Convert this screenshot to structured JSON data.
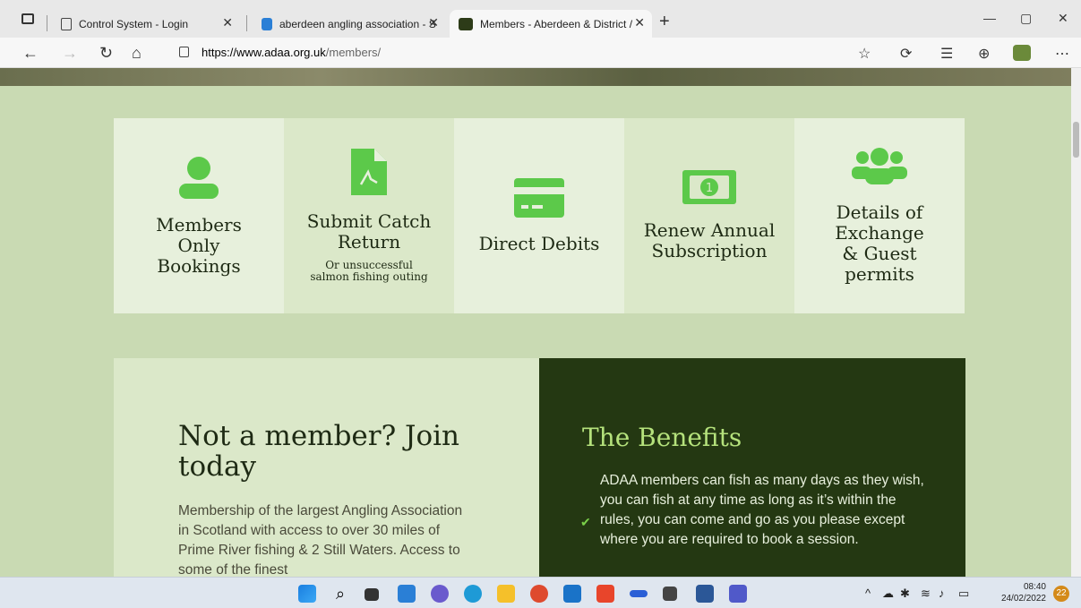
{
  "browser": {
    "tabs": [
      {
        "title": "Control System - Login",
        "active": false
      },
      {
        "title": "aberdeen angling association - S",
        "active": false
      },
      {
        "title": "Members - Aberdeen & District /",
        "active": true
      }
    ],
    "url_host": "https://www.adaa.org.uk",
    "url_path": "/members/"
  },
  "cards": [
    {
      "title": "Members Only Bookings",
      "subtitle": "",
      "icon": "user-icon"
    },
    {
      "title": "Submit Catch Return",
      "subtitle": "Or unsuccessful salmon fishing outing",
      "icon": "pdf-icon"
    },
    {
      "title": "Direct Debits",
      "subtitle": "",
      "icon": "credit-card-icon"
    },
    {
      "title": "Renew Annual Subscription",
      "subtitle": "",
      "icon": "money-bill-icon"
    },
    {
      "title": "Details of Exchange & Guest permits",
      "subtitle": "",
      "icon": "users-icon"
    }
  ],
  "join": {
    "title": "Not a member? Join today",
    "text": "Membership of the largest Angling Association in Scotland with access to over 30 miles of Prime River fishing & 2 Still Waters. Access to some of the finest"
  },
  "benefits": {
    "title": "The Benefits",
    "item": "ADAA members can fish as many days as they wish, you can fish at any time as long as it’s within the rules, you can come and go as you please except where you are required to book a session."
  },
  "taskbar": {
    "time": "08:40",
    "date": "24/02/2022",
    "notifications": "22"
  },
  "colors": {
    "page_bg": "#c9dab3",
    "card_light": "#e7f0dc",
    "card_mid": "#dbe8c9",
    "icon_green": "#5cc94a",
    "benefits_bg": "#243812",
    "benefits_title": "#b5e27c"
  }
}
